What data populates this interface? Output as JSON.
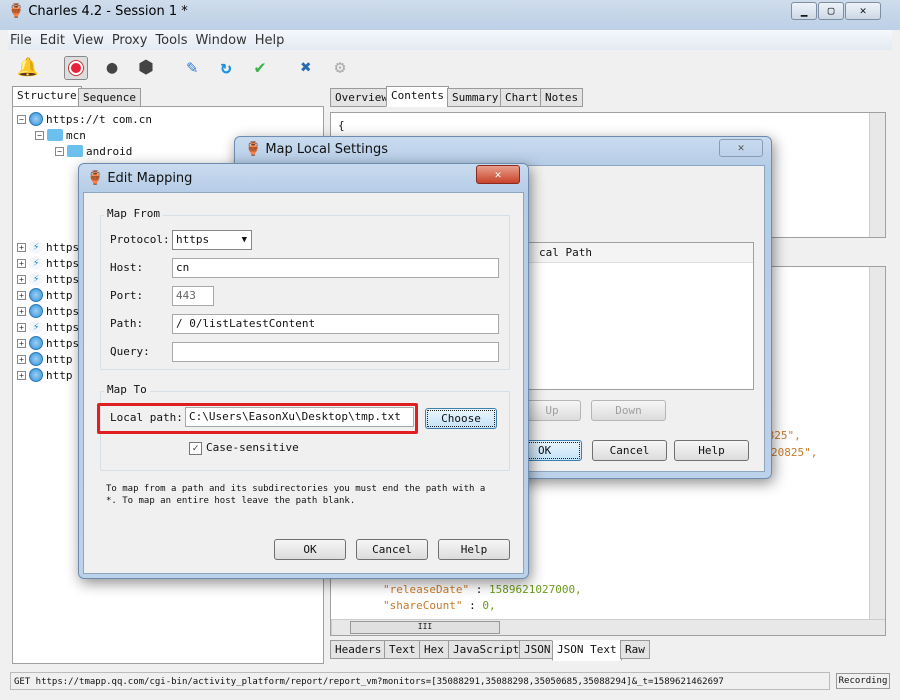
{
  "window": {
    "title": "Charles 4.2 - Session 1 *",
    "controls": [
      "minimize",
      "maximize",
      "close"
    ]
  },
  "menu": [
    "File",
    "Edit",
    "View",
    "Proxy",
    "Tools",
    "Window",
    "Help"
  ],
  "toolbar": {
    "icons": [
      "broom-icon",
      "record-icon",
      "turtle-icon",
      "stop-icon",
      "pen-icon",
      "refresh-icon",
      "check-icon",
      "tools-icon",
      "gear-icon"
    ],
    "record_color": "#e8203a"
  },
  "left": {
    "tabs": [
      "Structure",
      "Sequence"
    ],
    "active_tab": "Structure",
    "tree": {
      "root": "https://t                  com.cn",
      "children": [
        "mcn",
        "android"
      ],
      "hosts": [
        {
          "label": "https",
          "icon": "bolt"
        },
        {
          "label": "https",
          "icon": "bolt"
        },
        {
          "label": "https",
          "icon": "bolt"
        },
        {
          "label": "http",
          "icon": "globe"
        },
        {
          "label": "https",
          "icon": "globe"
        },
        {
          "label": "https",
          "icon": "bolt"
        },
        {
          "label": "https",
          "icon": "globe"
        },
        {
          "label": "http",
          "icon": "globe"
        },
        {
          "label": "http",
          "icon": "globe"
        }
      ]
    }
  },
  "right": {
    "tabs": [
      "Overview",
      "Contents",
      "Summary",
      "Chart",
      "Notes"
    ],
    "active_tab": "Contents",
    "top_text": "{",
    "json_lines": [
      {
        "key": "\"releaseDate\"",
        "value": "1589621027000,"
      },
      {
        "key": "\"shareCount\"",
        "value": "0,"
      }
    ],
    "fragments": [
      "0825\",",
      "20825\","
    ],
    "bottom_tabs": [
      "Headers",
      "Text",
      "Hex",
      "JavaScript",
      "JSON",
      "JSON Text",
      "Raw"
    ],
    "active_bottom_tab": "JSON Text",
    "hscroll_grip": "III"
  },
  "status": {
    "text": "GET https://tmapp.qq.com/cgi-bin/activity_platform/report/report_vm?monitors=[35088291,35088298,35050685,35088294]&_t=1589621462697",
    "recording": "Recording"
  },
  "map_local": {
    "title": "Map Local Settings",
    "column": "cal Path",
    "buttons": {
      "up": "Up",
      "down": "Down",
      "ok": "OK",
      "cancel": "Cancel",
      "help": "Help"
    },
    "close": "✕"
  },
  "edit_mapping": {
    "title": "Edit Mapping",
    "close": "✕",
    "map_from": {
      "legend": "Map From",
      "protocol_label": "Protocol:",
      "protocol": "https",
      "host_label": "Host:",
      "host": "                          cn",
      "port_label": "Port:",
      "port": "443",
      "path_label": "Path:",
      "path": "/                    0/listLatestContent",
      "query_label": "Query:",
      "query": ""
    },
    "map_to": {
      "legend": "Map To",
      "local_path_label": "Local path:",
      "local_path": "C:\\Users\\EasonXu\\Desktop\\tmp.txt",
      "choose": "Choose",
      "case_sensitive": "Case-sensitive",
      "case_sensitive_checked": true,
      "highlight_color": "#e02020"
    },
    "note": "To map from a path and its subdirectories you must end the path with a *. To map an entire host leave the path blank.",
    "buttons": {
      "ok": "OK",
      "cancel": "Cancel",
      "help": "Help"
    }
  }
}
